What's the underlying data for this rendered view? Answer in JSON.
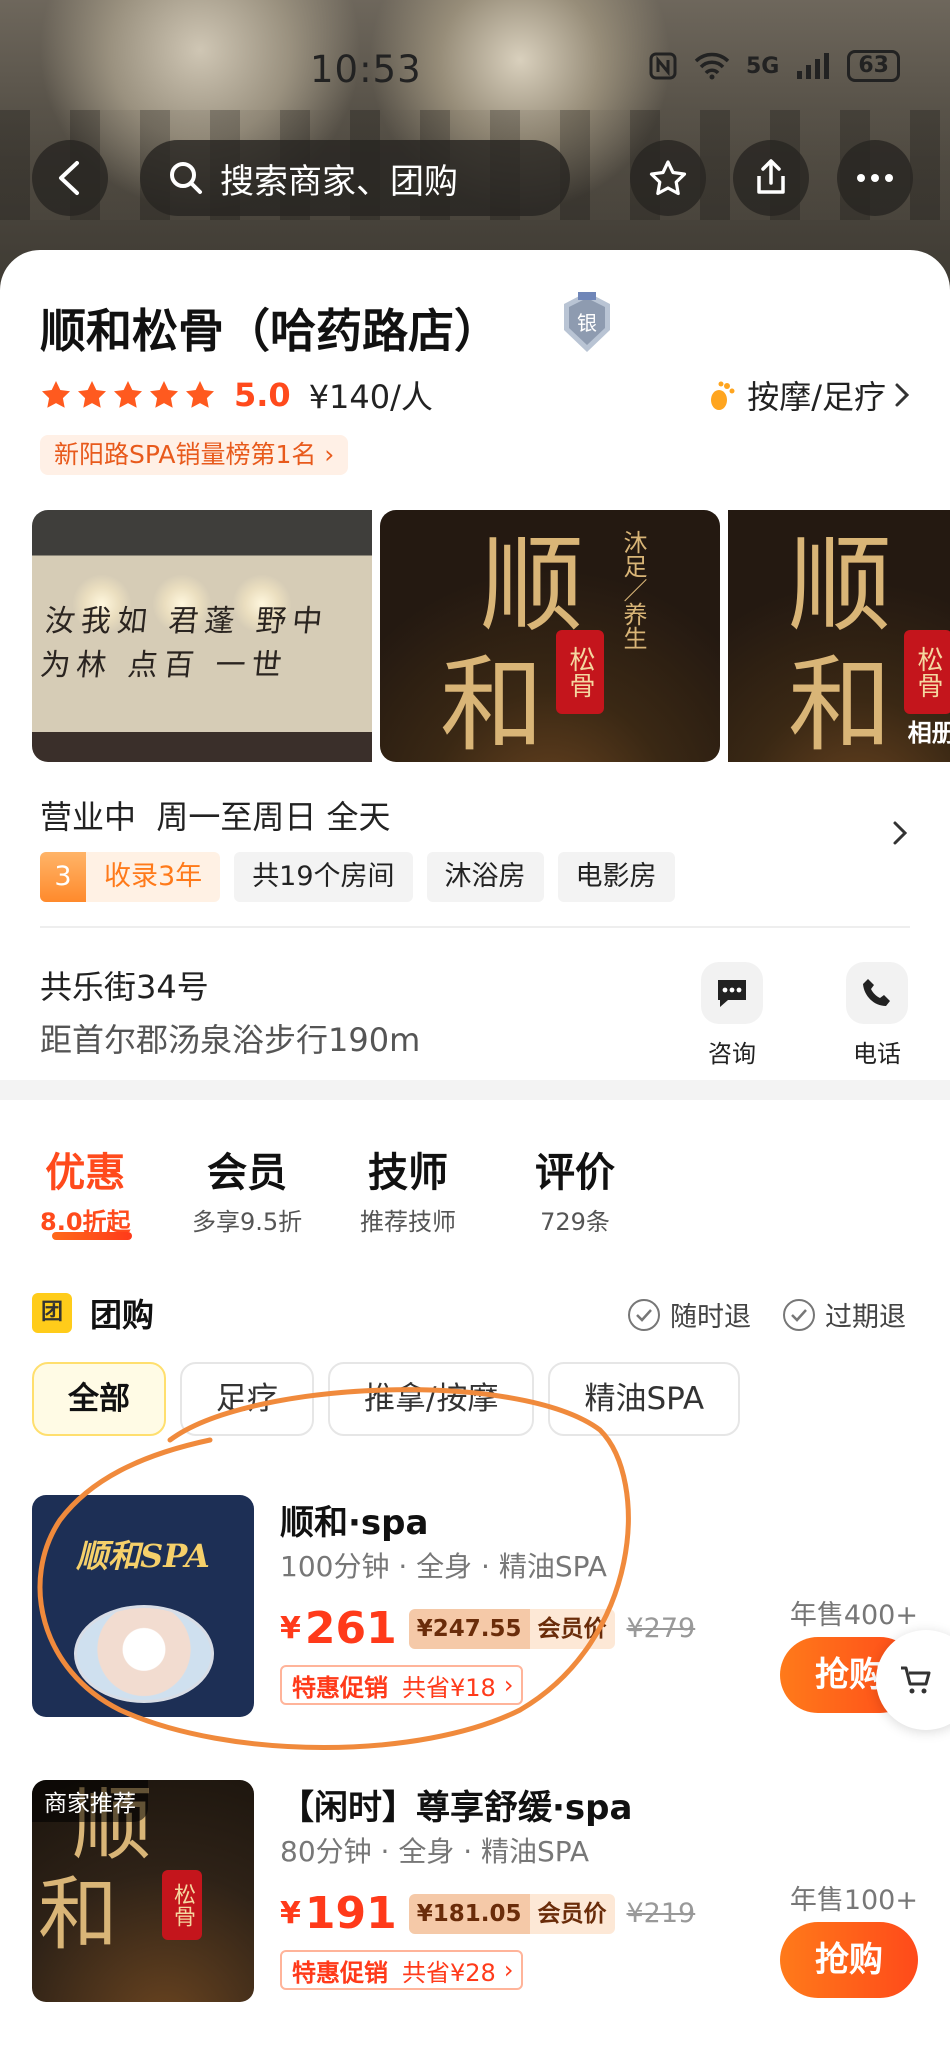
{
  "status_bar": {
    "time": "10:53",
    "network": "5G",
    "battery": "63"
  },
  "nav": {
    "search_placeholder": "搜索商家、团购"
  },
  "shop": {
    "name": "顺和松骨（哈药路店）",
    "badge": "银",
    "rating": "5.0",
    "price_per_person": "¥140/人",
    "category": "按摩/足疗",
    "rank_tag": "新阳路SPA销量榜第1名",
    "album_label": "相册",
    "gallery_text": {
      "big_char_1": "顺",
      "big_char_2": "和",
      "seal": "松骨",
      "slogan": "沐足／养生",
      "wall_calligraphy": "汝我如 君蓬 野中 为林 点百 一世"
    },
    "hours_status": "营业中",
    "hours": "周一至周日 全天",
    "tags": {
      "year_num": "3",
      "year_text": "收录3年",
      "rooms": "共19个房间",
      "bath": "沐浴房",
      "cinema": "电影房"
    },
    "address": "共乐街34号",
    "distance": "距首尔郡汤泉浴步行190m",
    "actions": {
      "consult": "咨询",
      "phone": "电话"
    }
  },
  "tabs": [
    {
      "title": "优惠",
      "sub": "8.0折起"
    },
    {
      "title": "会员",
      "sub": "多享9.5折"
    },
    {
      "title": "技师",
      "sub": "推荐技师"
    },
    {
      "title": "评价",
      "sub": "729条"
    }
  ],
  "group_buy": {
    "icon_text": "团",
    "title": "团购",
    "refund_any": "随时退",
    "refund_expired": "过期退",
    "filters": [
      "全部",
      "足疗",
      "推拿/按摩",
      "精油SPA"
    ]
  },
  "deals": [
    {
      "name": "顺和·spa",
      "desc": "100分钟 · 全身 · 精油SPA",
      "image_title": "顺和SPA",
      "yen": "¥",
      "price": "261",
      "member_price": "¥247.55",
      "member_label": "会员价",
      "original": "¥279",
      "promo": "特惠促销",
      "save": "共省¥18",
      "sold": "年售400+",
      "buy": "抢购"
    },
    {
      "name": "【闲时】尊享舒缓·spa",
      "desc": "80分钟 · 全身 · 精油SPA",
      "badge": "商家推荐",
      "yen": "¥",
      "price": "191",
      "member_price": "¥181.05",
      "member_label": "会员价",
      "original": "¥219",
      "promo": "特惠促销",
      "save": "共省¥28",
      "sold": "年售100+",
      "buy": "抢购"
    }
  ],
  "colors": {
    "accent": "#ff4a1c",
    "annotation": "#f08a3c",
    "gold": "#ffcc1a"
  }
}
